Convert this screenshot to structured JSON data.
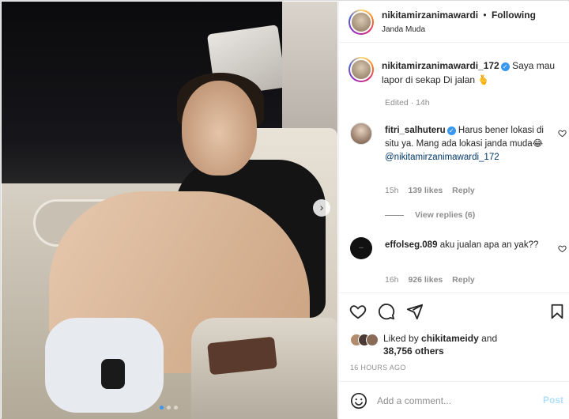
{
  "post": {
    "author": "nikitamirzanimawardi",
    "separator": "•",
    "follow_status": "Following",
    "location": "Janda Muda"
  },
  "caption": {
    "author": "nikitamirzanimawardi_172",
    "text": "Saya mau lapor di sekap Di jalan",
    "emoji": "🫰",
    "meta": "Edited · 14h"
  },
  "comments": [
    {
      "author": "fitri_salhuteru",
      "verified": true,
      "text": "Harus bener lokasi di situ ya. Mang ada lokasi janda muda",
      "emoji": "😂",
      "mention": "@nikitamirzanimawardi_172",
      "time": "15h",
      "likes": "139 likes",
      "reply_label": "Reply",
      "view_replies": "View replies (6)"
    },
    {
      "author": "effolseg.089",
      "verified": false,
      "text": "aku jualan apa an yak??",
      "time": "16h",
      "likes": "926 likes",
      "reply_label": "Reply"
    }
  ],
  "actions": {
    "icons": [
      "heart-icon",
      "comment-icon",
      "share-icon",
      "bookmark-icon"
    ]
  },
  "likes": {
    "prefix": "Liked by",
    "user": "chikitameidy",
    "conjunction": "and",
    "count": "38,756 others"
  },
  "date": "16 HOURS AGO",
  "add_comment": {
    "placeholder": "Add a comment...",
    "post_label": "Post"
  },
  "carousel": {
    "slides": 3,
    "active": 1
  },
  "colors": {
    "link": "#00376b",
    "verified": "#3897f0",
    "post_disabled": "#b2dffc",
    "muted": "#8e8e8e"
  }
}
